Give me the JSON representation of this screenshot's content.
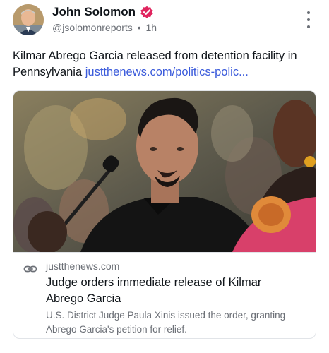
{
  "post": {
    "author": {
      "display_name": "John Solomon",
      "handle": "@jsolomonreports",
      "separator": "•",
      "time": "1h",
      "avatar_icon": "avatar-photo",
      "verified_icon": "verified-badge-icon",
      "verified_color": "#e0245e"
    },
    "text": "Kilmar Abrego Garcia released from detention facility in Pennsylvania",
    "link_text": "justthenews.com/politics-polic...",
    "menu_icon": "more-vertical-icon",
    "card": {
      "image_icon": "news-photo",
      "link_icon": "link-icon",
      "domain": "justthenews.com",
      "title": "Judge orders immediate release of Kilmar Abrego Garcia",
      "description": "U.S. District Judge Paula Xinis issued the order, granting Abrego Garcia's petition for relief."
    }
  },
  "colors": {
    "link": "#3b5bdb",
    "secondary_text": "#6b6f76",
    "primary_text": "#0f1419",
    "border": "#e1e4e8"
  }
}
